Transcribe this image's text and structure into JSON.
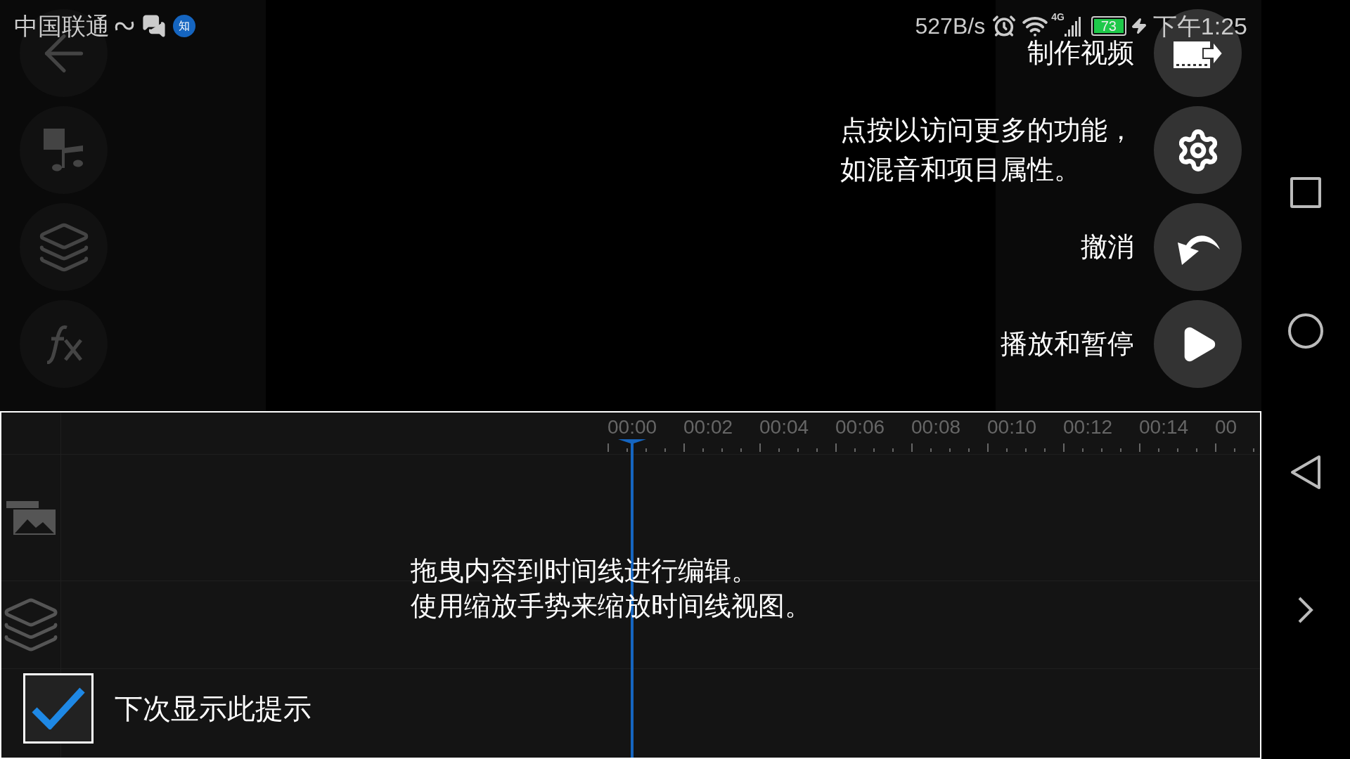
{
  "status_bar": {
    "carrier": "中国联通",
    "badge": "知",
    "network_speed": "527B/s",
    "network_type": "4G",
    "battery": "73",
    "time": "下午1:25"
  },
  "right_actions": [
    {
      "kind": "export",
      "label_lines": [
        "制作视频"
      ]
    },
    {
      "kind": "settings",
      "label_lines": [
        "点按以访问更多的功能，",
        "如混音和项目属性。"
      ]
    },
    {
      "kind": "undo",
      "label_lines": [
        "撤消"
      ]
    },
    {
      "kind": "play",
      "label_lines": [
        "播放和暂停"
      ]
    }
  ],
  "timeline": {
    "ruler_labels": [
      "00:00",
      "00:02",
      "00:04",
      "00:06",
      "00:08",
      "00:10",
      "00:12",
      "00:14",
      "00"
    ],
    "hint_lines": [
      "拖曳内容到时间线进行编辑。",
      "使用缩放手势来缩放时间线视图。"
    ],
    "show_hint": {
      "label": "下次显示此提示",
      "checked": true
    }
  }
}
